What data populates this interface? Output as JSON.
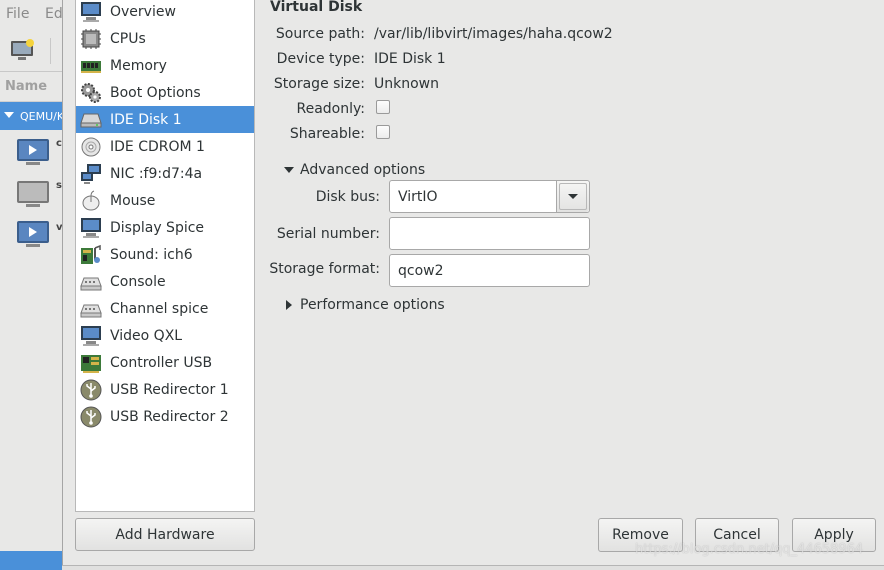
{
  "background_window": {
    "menu": [
      "File",
      "Ed"
    ],
    "name_header": "Name",
    "group_label": "QEMU/K",
    "vm_letters": [
      "c",
      "s",
      "v"
    ]
  },
  "sidebar": {
    "items": [
      {
        "label": "Overview",
        "icon": "monitor-icon"
      },
      {
        "label": "CPUs",
        "icon": "cpu-chip-icon"
      },
      {
        "label": "Memory",
        "icon": "memory-module-icon"
      },
      {
        "label": "Boot Options",
        "icon": "gears-icon"
      },
      {
        "label": "IDE Disk 1",
        "icon": "hard-disk-icon",
        "selected": true
      },
      {
        "label": "IDE CDROM 1",
        "icon": "cdrom-icon"
      },
      {
        "label": "NIC :f9:d7:4a",
        "icon": "network-card-icon"
      },
      {
        "label": "Mouse",
        "icon": "mouse-icon"
      },
      {
        "label": "Display Spice",
        "icon": "display-monitor-icon"
      },
      {
        "label": "Sound: ich6",
        "icon": "sound-card-icon"
      },
      {
        "label": "Console",
        "icon": "serial-console-icon"
      },
      {
        "label": "Channel spice",
        "icon": "channel-icon"
      },
      {
        "label": "Video QXL",
        "icon": "video-monitor-icon"
      },
      {
        "label": "Controller USB",
        "icon": "controller-card-icon"
      },
      {
        "label": "USB Redirector 1",
        "icon": "usb-icon"
      },
      {
        "label": "USB Redirector 2",
        "icon": "usb-icon"
      }
    ],
    "add_hardware_label": "Add Hardware"
  },
  "details": {
    "section_title": "Virtual Disk",
    "source_path_label": "Source path:",
    "source_path_value": "/var/lib/libvirt/images/haha.qcow2",
    "device_type_label": "Device type:",
    "device_type_value": "IDE Disk 1",
    "storage_size_label": "Storage size:",
    "storage_size_value": "Unknown",
    "readonly_label": "Readonly:",
    "shareable_label": "Shareable:",
    "advanced_options_label": "Advanced options",
    "disk_bus_label": "Disk bus:",
    "disk_bus_value": "VirtIO",
    "serial_number_label": "Serial number:",
    "serial_number_value": "",
    "storage_format_label": "Storage format:",
    "storage_format_value": "qcow2",
    "performance_options_label": "Performance options"
  },
  "buttons": {
    "remove": "Remove",
    "cancel": "Cancel",
    "apply": "Apply"
  },
  "watermark": "https://blog.csdn.net/qq_44658964",
  "colors": {
    "selection": "#4a90d9",
    "window_bg": "#e8e8e7"
  }
}
